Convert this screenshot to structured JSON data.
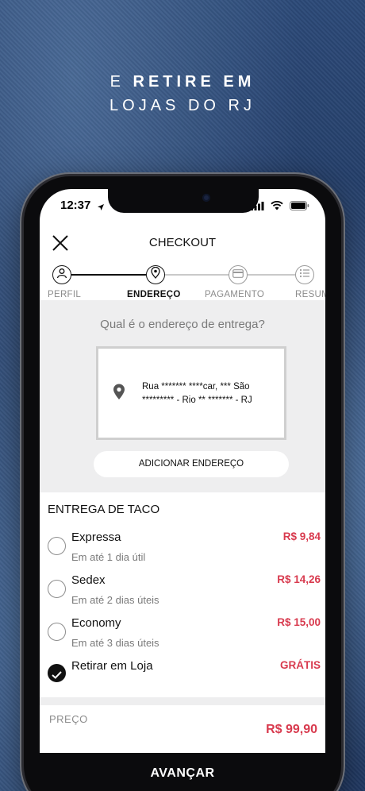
{
  "promo": {
    "line1_prefix": "E",
    "line1_bold": "RETIRE EM",
    "line2": "LOJAS DO RJ"
  },
  "statusbar": {
    "time": "12:37"
  },
  "header": {
    "title": "CHECKOUT"
  },
  "steps": [
    {
      "label": "PERFIL",
      "icon": "user-icon",
      "state": "done"
    },
    {
      "label": "ENDEREÇO",
      "icon": "location-pin-icon",
      "state": "active"
    },
    {
      "label": "PAGAMENTO",
      "icon": "credit-card-icon",
      "state": "pending"
    },
    {
      "label": "RESUMO",
      "icon": "list-icon",
      "state": "pending"
    }
  ],
  "address": {
    "question": "Qual é o endereço de entrega?",
    "selected": "Rua ******* ****car, *** São ********* - Rio ** ******* - RJ",
    "add_button": "ADICIONAR ENDEREÇO"
  },
  "delivery": {
    "title": "ENTREGA DE TACO",
    "options": [
      {
        "name": "Expressa",
        "eta": "Em até 1 dia útil",
        "price": "R$  9,84",
        "selected": false
      },
      {
        "name": "Sedex",
        "eta": "Em até 2 dias úteis",
        "price": "R$  14,26",
        "selected": false
      },
      {
        "name": "Economy",
        "eta": "Em até 3 dias úteis",
        "price": "R$  15,00",
        "selected": false
      },
      {
        "name": "Retirar em Loja",
        "eta": "",
        "price": "GRÁTIS",
        "selected": true
      }
    ]
  },
  "summary": {
    "price_label": "PREÇO",
    "price_value": "R$  99,90"
  },
  "footer": {
    "advance_label": "AVANÇAR"
  },
  "colors": {
    "accent_red": "#d83a4e",
    "dark": "#0b0b0d",
    "gray_bg": "#eeeeef"
  }
}
